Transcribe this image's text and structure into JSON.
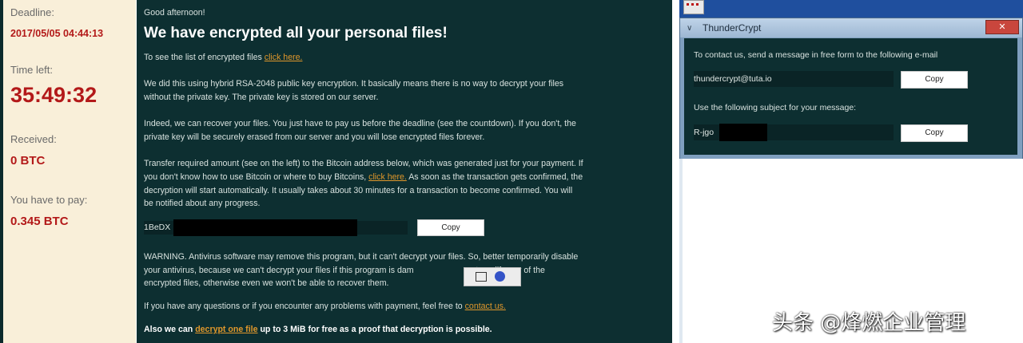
{
  "status": {
    "deadline_label": "Deadline:",
    "deadline_value": "2017/05/05 04:44:13",
    "time_left_label": "Time left:",
    "time_left_value": "35:49:32",
    "received_label": "Received:",
    "received_value": "0 BTC",
    "pay_label": "You have to pay:",
    "pay_value": "0.345 BTC"
  },
  "note": {
    "greeting": "Good afternoon!",
    "heading": "We have encrypted all your personal files!",
    "list_prefix": "To see the list of encrypted files",
    "list_link": "click here.",
    "para1_line1": "We did this using hybrid RSA-2048 public key encryption. It basically means there is no way to decrypt your files",
    "para1_line2": "without the private key. The private key is stored on our server.",
    "para2_line1": "Indeed, we can recover your files. You just have to pay us before the deadline (see the countdown). If you don't, the",
    "para2_line2": "private key will be securely erased from our server and you will lose encrypted files forever.",
    "para3_line1": "Transfer required amount (see on the left) to the Bitcoin address below, which was generated just for your payment. If",
    "para3_line2_pre": "you don't know how to use Bitcoin or where to buy Bitcoins,",
    "para3_link": "click here.",
    "para3_line2_post": "As soon as the transaction gets confirmed, the",
    "para3_line3": "decryption will start automatically. It usually takes about 30 minutes for a transaction to become confirmed. You will",
    "para3_line4": "be notified about any progress.",
    "btc_address_prefix": "1BeDX",
    "copy_label": "Copy",
    "warn_line1": "WARNING. Antivirus software may remove this program, but it can't decrypt your files. So, better temporarily disable",
    "warn_line2_pre": "your antivirus, because we can't decrypt your files if this program is dam",
    "warn_line2_post": "not modify any of the",
    "warn_line3": "encrypted files, otherwise even we won't be able to recover them.",
    "contact_pre": "If you have any questions or if you encounter any problems with payment, feel free to",
    "contact_link": "contact us.",
    "free_pre": "Also we can",
    "free_link": "decrypt one file",
    "free_post": "up to 3 MiB for free as a proof that decryption is possible."
  },
  "window": {
    "title": "ThunderCrypt",
    "close": "✕",
    "contact_text": "To contact us, send a message in free form to the following e-mail",
    "email": "thundercrypt@tuta.io",
    "copy_label": "Copy",
    "subject_text": "Use the following subject for your message:",
    "subject_prefix": "R-jgo"
  },
  "watermark": "头条 @烽燃企业管理",
  "colors": {
    "panel_bg": "#f9efd9",
    "value_red": "#b31919",
    "note_bg": "#0d2f31",
    "link_orange": "#e0972b"
  }
}
